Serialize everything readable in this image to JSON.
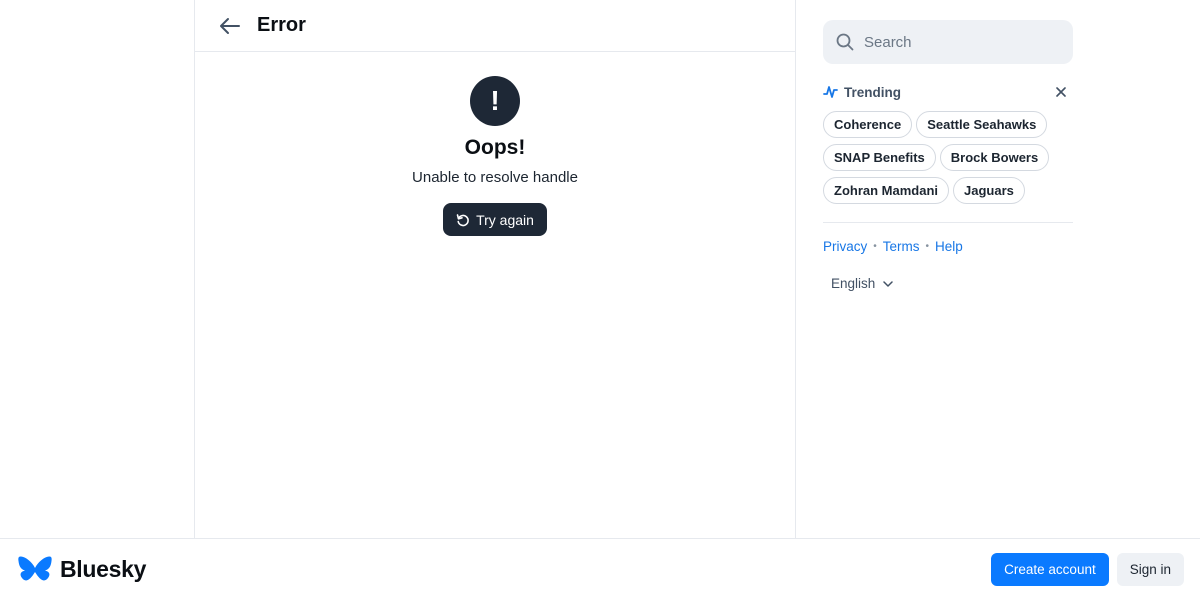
{
  "header": {
    "title": "Error"
  },
  "error": {
    "icon_glyph": "!",
    "title": "Oops!",
    "message": "Unable to resolve handle",
    "retry_label": "Try again"
  },
  "search": {
    "placeholder": "Search"
  },
  "trending": {
    "label": "Trending",
    "topics": [
      "Coherence",
      "Seattle Seahawks",
      "SNAP Benefits",
      "Brock Bowers",
      "Zohran Mamdani",
      "Jaguars"
    ]
  },
  "links": {
    "privacy": "Privacy",
    "terms": "Terms",
    "help": "Help",
    "separator": "•"
  },
  "language": {
    "selected": "English"
  },
  "footer": {
    "brand": "Bluesky",
    "create_account": "Create account",
    "sign_in": "Sign in"
  },
  "colors": {
    "brand_blue": "#0a7aff",
    "link_blue": "#1877e6",
    "dark_button": "#1e2836",
    "trending_icon": "#1877e6"
  },
  "icons": {
    "back": "arrow-left-icon",
    "error": "exclamation-icon",
    "retry": "refresh-icon",
    "search": "search-icon",
    "trending": "trending-pulse-icon",
    "close": "close-icon",
    "chevron": "chevron-down-icon",
    "logo": "butterfly-logo-icon"
  }
}
